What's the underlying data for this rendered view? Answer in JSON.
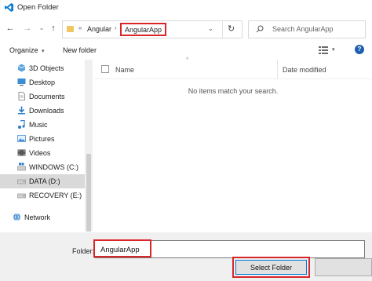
{
  "window": {
    "title": "Open Folder"
  },
  "nav": {
    "back_glyph": "←",
    "forward_glyph": "→",
    "recent_glyph": "⌄",
    "up_glyph": "↑",
    "breadcrumb": [
      "Angular",
      "AngularApp"
    ],
    "breadcrumb_sep": "›",
    "overflow_glyph": "«",
    "dropdown_glyph": "⌄",
    "refresh_glyph": "↻"
  },
  "search": {
    "placeholder": "Search AngularApp"
  },
  "toolbar": {
    "organize_label": "Organize",
    "organize_dd": "▾",
    "new_folder_label": "New folder",
    "view_dd": "▾",
    "help_glyph": "?"
  },
  "sidebar": {
    "items": [
      {
        "label": "3D Objects",
        "icon": "3d-objects-icon"
      },
      {
        "label": "Desktop",
        "icon": "desktop-icon"
      },
      {
        "label": "Documents",
        "icon": "documents-icon"
      },
      {
        "label": "Downloads",
        "icon": "downloads-icon"
      },
      {
        "label": "Music",
        "icon": "music-icon"
      },
      {
        "label": "Pictures",
        "icon": "pictures-icon"
      },
      {
        "label": "Videos",
        "icon": "videos-icon"
      },
      {
        "label": "WINDOWS (C:)",
        "icon": "drive-c-icon"
      },
      {
        "label": "DATA (D:)",
        "icon": "drive-d-icon",
        "selected": true
      },
      {
        "label": "RECOVERY (E:)",
        "icon": "drive-e-icon"
      },
      {
        "label": "Network",
        "icon": "network-icon"
      }
    ]
  },
  "filepane": {
    "columns": [
      "Name",
      "Date modified"
    ],
    "empty_message": "No items match your search.",
    "sort_glyph": "^"
  },
  "footer": {
    "folder_label": "Folder:",
    "folder_value": "AngularApp",
    "select_button": "Select Folder"
  },
  "colors": {
    "highlight_red": "#d9262b",
    "accent_blue": "#0078d7",
    "selected_bg": "#d9d9d9",
    "footer_bg": "#f0f0f0"
  }
}
